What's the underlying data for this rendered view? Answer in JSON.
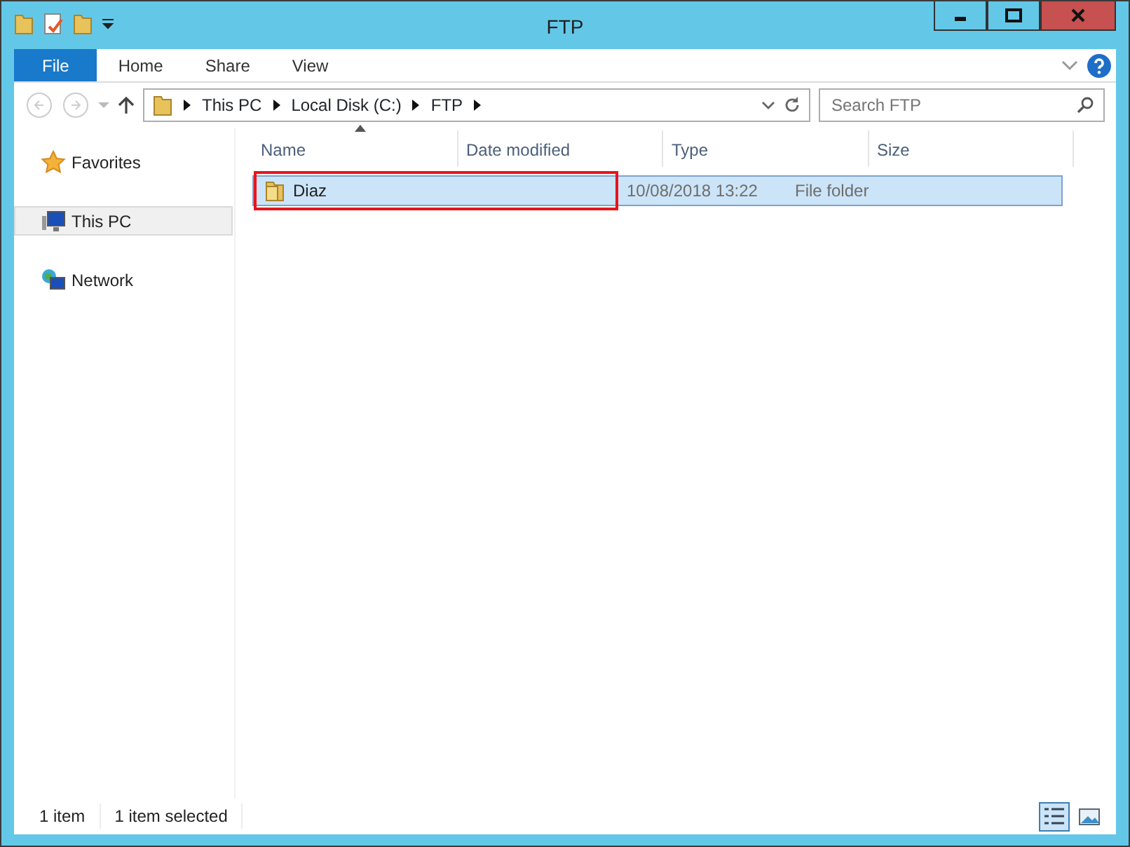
{
  "window": {
    "title": "FTP"
  },
  "ribbon_tabs": [
    {
      "label": "File",
      "kind": "file"
    },
    {
      "label": "Home",
      "kind": "tab"
    },
    {
      "label": "Share",
      "kind": "tab"
    },
    {
      "label": "View",
      "kind": "tab"
    }
  ],
  "address_bar": {
    "segments": [
      "This PC",
      "Local Disk (C:)",
      "FTP"
    ]
  },
  "search": {
    "placeholder": "Search FTP"
  },
  "navigation": [
    {
      "label": "Favorites",
      "kind": "favorites",
      "selected": false
    },
    {
      "label": "This PC",
      "kind": "computer",
      "selected": true
    },
    {
      "label": "Network",
      "kind": "network",
      "selected": false
    }
  ],
  "columns": [
    {
      "label": "Name",
      "sorted": true
    },
    {
      "label": "Date modified",
      "sorted": false
    },
    {
      "label": "Type",
      "sorted": false
    },
    {
      "label": "Size",
      "sorted": false
    }
  ],
  "rows": [
    {
      "name": "Diaz",
      "date_modified": "10/08/2018 13:22",
      "type": "File folder",
      "selected": true,
      "outlined": true
    }
  ],
  "status_bar": [
    "1 item",
    "1 item selected"
  ],
  "view_buttons": [
    {
      "kind": "details",
      "selected": true
    },
    {
      "kind": "large-icons",
      "selected": false
    }
  ]
}
